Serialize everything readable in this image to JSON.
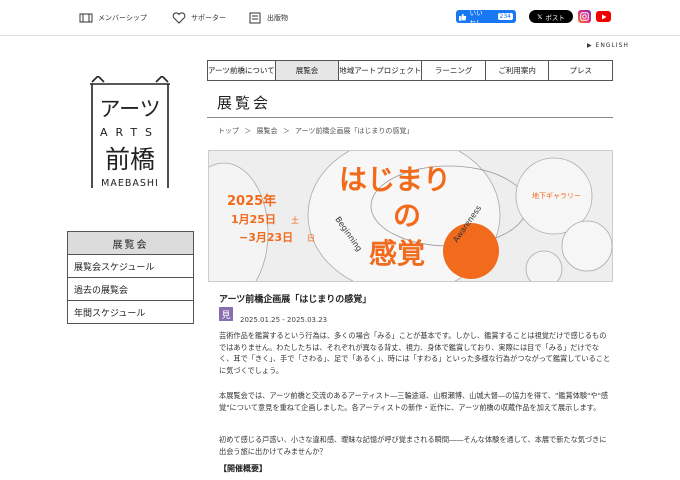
{
  "topbar": {
    "membership": "メンバーシップ",
    "supporter": "サポーター",
    "publications": "出版物",
    "facebook_like": "いいね！",
    "facebook_count": "234",
    "x_post": "ポスト",
    "english": "ENGLISH"
  },
  "logo": {
    "top": "アーツ",
    "arts": "ARTS",
    "bottom": "前橋",
    "roman": "MAEBASHI"
  },
  "nav": {
    "items": [
      "アーツ前橋について",
      "展覧会",
      "地域アートプロジェクト",
      "ラーニング",
      "ご利用案内",
      "プレス"
    ]
  },
  "page": {
    "title": "展覧会",
    "breadcrumb": [
      "トップ",
      "＞",
      "展覧会",
      "＞",
      "アーツ前橋企画展「はじまりの感覚」"
    ]
  },
  "banner": {
    "year": "2025年",
    "start": "1月25日",
    "start_day": "土",
    "end": "−3月23日",
    "end_day": "日",
    "title_1": "はじまり",
    "title_2": "の",
    "title_3": "感覚",
    "beginning": "Beginning",
    "awareness": "Awareness",
    "venue": "地下ギャラリー",
    "accent_color": "#f26a1b",
    "text_color": "#f26a1b"
  },
  "sidebar": {
    "heading": "展覧会",
    "items": [
      "展覧会スケジュール",
      "過去の展覧会",
      "年間スケジュール"
    ]
  },
  "event": {
    "title": "アーツ前橋企画展「はじまりの感覚」",
    "mark": "見",
    "date": "2025.01.25 - 2025.03.23",
    "para1": "芸術作品を鑑賞するという行為は、多くの場合「みる」ことが基本です。しかし、鑑賞することは視覚だけで感じるものではありません。わたしたちは、それぞれが異なる背丈、視力、身体で鑑賞しており、実際には目で「みる」だけでなく、耳で「きく」、手で「さわる」、足で「あるく」、時には「すわる」といった多様な行為がつながって鑑賞していることに気づくでしょう。",
    "para2": "本展覧会では、アーツ前橋と交流のあるアーティスト―三輪途道、山根瀬博、山城大督―の協力を得て、\"鑑賞体験\"や\"感覚\"について意見を重ねて企画しました。各アーティストの新作・近作に、アーツ前橋の収蔵作品を加えて展示します。",
    "para3": "初めて感じる戸惑い、小さな違和感、曖昧な記憶が呼び覚まされる瞬間――そんな体験を通して、本展で新たな気づきに出会う旅に出かけてみませんか？",
    "outline_heading": "【開催概要】"
  }
}
